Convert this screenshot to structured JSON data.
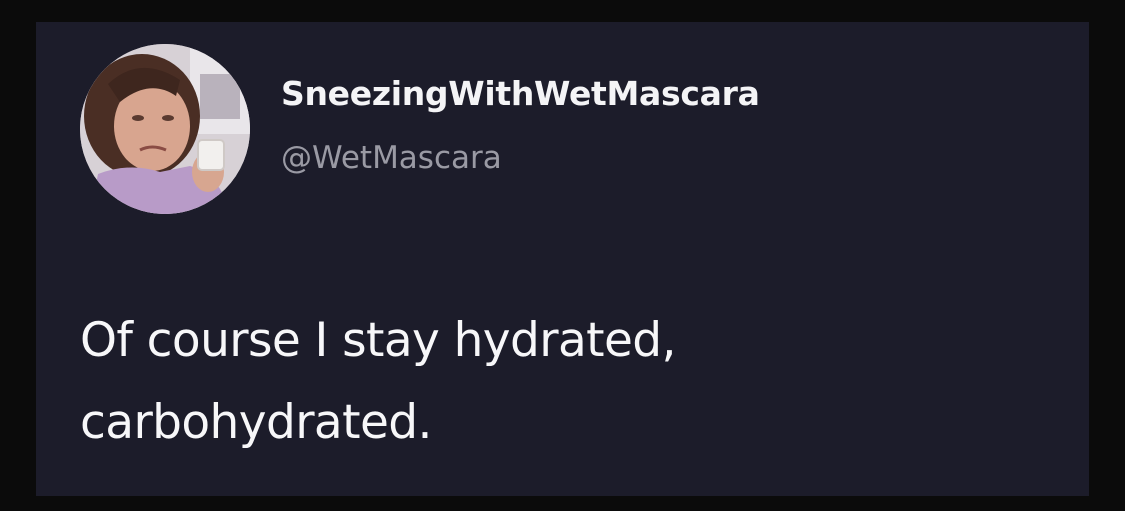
{
  "tweet": {
    "display_name": "SneezingWithWetMascara",
    "handle": "@WetMascara",
    "text_lines": [
      "Of course I stay hydrated,",
      "carbohydrated."
    ]
  },
  "colors": {
    "card_background": "#1c1c2a",
    "outer_background": "#0b0b0b",
    "name_color": "#f4f4f6",
    "handle_color": "#9a9aa4",
    "text_color": "#f7f7f9"
  },
  "icons": {
    "avatar": "profile-photo-avatar"
  }
}
